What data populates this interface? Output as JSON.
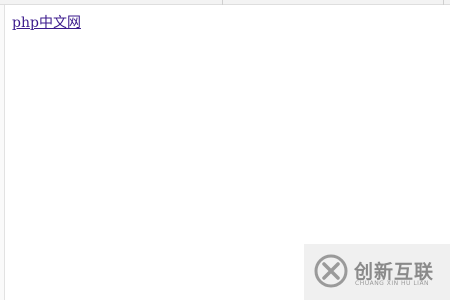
{
  "link": {
    "text": "php中文网"
  },
  "watermark": {
    "brand_cn": "创新互联",
    "brand_en": "CHUANG XIN HU LIAN",
    "logo_icon": "x-circle-logo-icon",
    "color": "#8a8a8a"
  },
  "colors": {
    "link": "#3b1a8c",
    "background": "#ffffff"
  }
}
